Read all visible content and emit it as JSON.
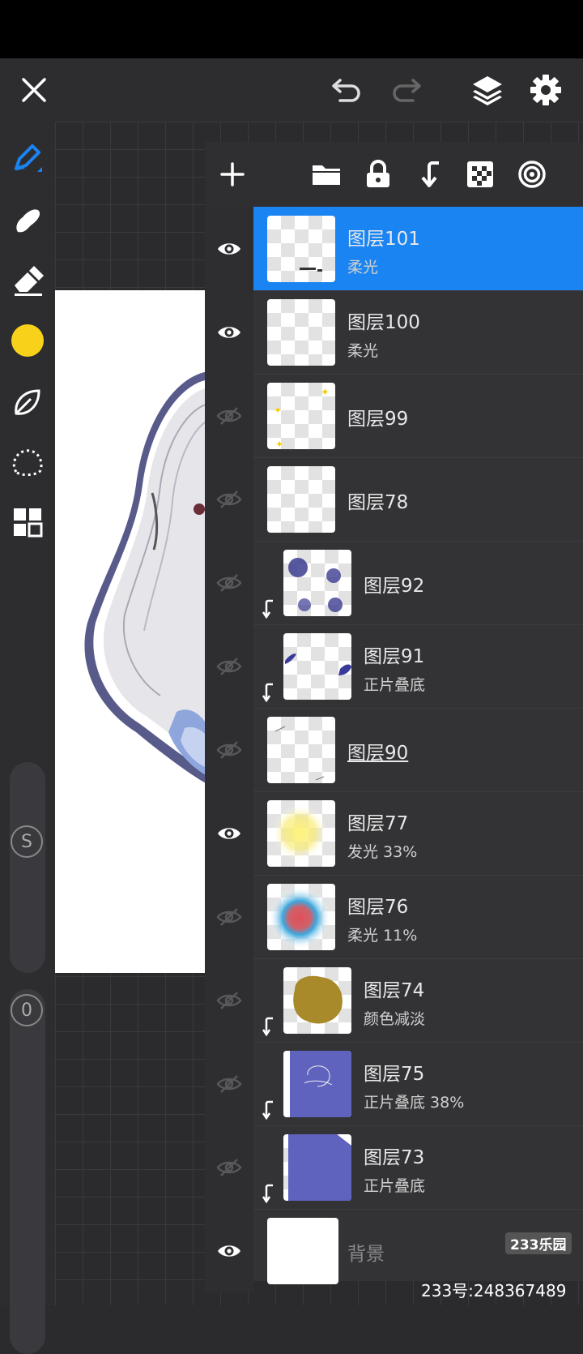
{
  "toolbar": {
    "close_icon": "close-icon",
    "undo_icon": "undo-icon",
    "redo_icon": "redo-icon",
    "layers_icon": "layers-icon",
    "settings_icon": "gear-icon"
  },
  "tools": {
    "brush_color": "#1a84f2",
    "current_color": "#f8d21a",
    "slider_size_label": "S",
    "slider_opacity_label": "0"
  },
  "layers_panel": {
    "actions": [
      "add-icon",
      "folder-icon",
      "lock-icon",
      "merge-down-icon",
      "transparency-icon",
      "blend-icon"
    ],
    "layers": [
      {
        "name": "图层101",
        "mode": "柔光",
        "visible": true,
        "selected": true,
        "clipped": false
      },
      {
        "name": "图层100",
        "mode": "柔光",
        "visible": true,
        "selected": false,
        "clipped": false
      },
      {
        "name": "图层99",
        "mode": "",
        "visible": false,
        "selected": false,
        "clipped": false
      },
      {
        "name": "图层78",
        "mode": "",
        "visible": false,
        "selected": false,
        "clipped": false
      },
      {
        "name": "图层92",
        "mode": "",
        "visible": false,
        "selected": false,
        "clipped": true
      },
      {
        "name": "图层91",
        "mode": "正片叠底",
        "visible": false,
        "selected": false,
        "clipped": true
      },
      {
        "name": "图层90",
        "mode": "",
        "visible": false,
        "selected": false,
        "clipped": false
      },
      {
        "name": "图层77",
        "mode": "发光  33%",
        "visible": true,
        "selected": false,
        "clipped": false
      },
      {
        "name": "图层76",
        "mode": "柔光  11%",
        "visible": false,
        "selected": false,
        "clipped": false
      },
      {
        "name": "图层74",
        "mode": "颜色减淡",
        "visible": false,
        "selected": false,
        "clipped": true
      },
      {
        "name": "图层75",
        "mode": "正片叠底  38%",
        "visible": false,
        "selected": false,
        "clipped": true
      },
      {
        "name": "图层73",
        "mode": "正片叠底",
        "visible": false,
        "selected": false,
        "clipped": true
      },
      {
        "name": "背景",
        "mode": "",
        "visible": true,
        "selected": false,
        "clipped": false
      }
    ]
  },
  "watermark": {
    "logo": "233乐园",
    "id_text": "233号:248367489"
  }
}
